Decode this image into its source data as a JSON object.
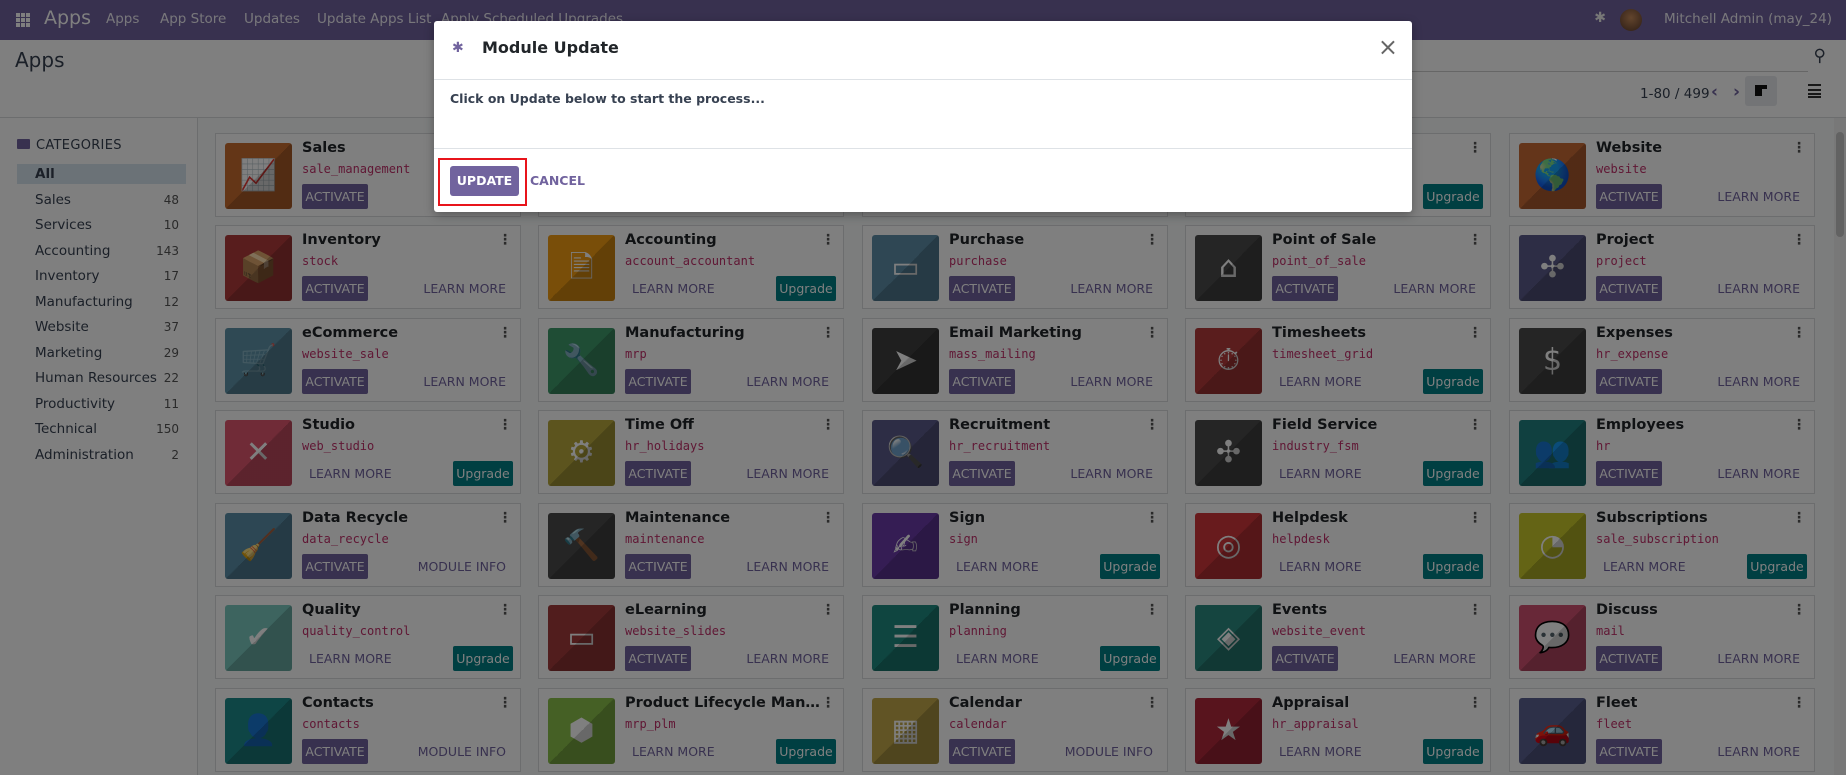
{
  "navbar": {
    "brand": "Apps",
    "items": [
      "Apps",
      "App Store",
      "Updates",
      "Update Apps List",
      "Apply Scheduled Upgrades"
    ],
    "user": "Mitchell Admin (may_24)"
  },
  "control_panel": {
    "title": "Apps",
    "pager": "1-80 / 499"
  },
  "sidebar": {
    "header": "CATEGORIES",
    "items": [
      {
        "label": "All",
        "count": ""
      },
      {
        "label": "Sales",
        "count": "48"
      },
      {
        "label": "Services",
        "count": "10"
      },
      {
        "label": "Accounting",
        "count": "143"
      },
      {
        "label": "Inventory",
        "count": "17"
      },
      {
        "label": "Manufacturing",
        "count": "12"
      },
      {
        "label": "Website",
        "count": "37"
      },
      {
        "label": "Marketing",
        "count": "29"
      },
      {
        "label": "Human Resources",
        "count": "22"
      },
      {
        "label": "Productivity",
        "count": "11"
      },
      {
        "label": "Technical",
        "count": "150"
      },
      {
        "label": "Administration",
        "count": "2"
      }
    ]
  },
  "colors": {
    "primary": "#71639e",
    "upgrade": "#017e84",
    "highlight": "#e8141b"
  },
  "cards": [
    [
      {
        "name": "Sales",
        "tech": "sale_management",
        "icon": "chart-up-icon",
        "glyph": "📈",
        "color": "#c96d2f",
        "activate": "ACTIVATE"
      },
      {
        "hidden": true
      },
      {
        "hidden": true
      },
      {
        "upgrade": "Upgrade"
      },
      {
        "name": "Website",
        "tech": "website",
        "icon": "globe-icon",
        "glyph": "🌎",
        "color": "#c86a35",
        "activate": "ACTIVATE",
        "link": "LEARN MORE"
      }
    ],
    [
      {
        "name": "Inventory",
        "tech": "stock",
        "icon": "box-icon",
        "glyph": "📦",
        "color": "#b03a3a",
        "activate": "ACTIVATE",
        "link": "LEARN MORE"
      },
      {
        "name": "Accounting",
        "tech": "account_accountant",
        "icon": "document-icon",
        "glyph": "🗎",
        "color": "#f39c12",
        "link": "LEARN MORE",
        "upgrade": "Upgrade"
      },
      {
        "name": "Purchase",
        "tech": "purchase",
        "icon": "credit-card-icon",
        "glyph": "▭",
        "color": "#5e8fa8",
        "activate": "ACTIVATE",
        "link": "LEARN MORE"
      },
      {
        "name": "Point of Sale",
        "tech": "point_of_sale",
        "icon": "store-icon",
        "glyph": "⌂",
        "color": "#4a4a4a",
        "activate": "ACTIVATE",
        "link": "LEARN MORE"
      },
      {
        "name": "Project",
        "tech": "project",
        "icon": "puzzle-icon",
        "glyph": "✣",
        "color": "#5a5a8a",
        "activate": "ACTIVATE",
        "link": "LEARN MORE"
      }
    ],
    [
      {
        "name": "eCommerce",
        "tech": "website_sale",
        "icon": "cart-icon",
        "glyph": "🛒",
        "color": "#5f93a8",
        "activate": "ACTIVATE",
        "link": "LEARN MORE"
      },
      {
        "name": "Manufacturing",
        "tech": "mrp",
        "icon": "wrench-icon",
        "glyph": "🔧",
        "color": "#3f9a6b",
        "activate": "ACTIVATE",
        "link": "LEARN MORE"
      },
      {
        "name": "Email Marketing",
        "tech": "mass_mailing",
        "icon": "paper-plane-icon",
        "glyph": "➤",
        "color": "#3e3e3e",
        "activate": "ACTIVATE",
        "link": "LEARN MORE"
      },
      {
        "name": "Timesheets",
        "tech": "timesheet_grid",
        "icon": "stopwatch-icon",
        "glyph": "⏱",
        "color": "#b53a3a",
        "link": "LEARN MORE",
        "upgrade": "Upgrade"
      },
      {
        "name": "Expenses",
        "tech": "hr_expense",
        "icon": "user-dollar-icon",
        "glyph": "$",
        "color": "#4a4a4a",
        "activate": "ACTIVATE",
        "link": "LEARN MORE"
      }
    ],
    [
      {
        "name": "Studio",
        "tech": "web_studio",
        "icon": "tools-icon",
        "glyph": "✕",
        "color": "#e0576e",
        "link": "LEARN MORE",
        "upgrade": "Upgrade"
      },
      {
        "name": "Time Off",
        "tech": "hr_holidays",
        "icon": "user-gear-icon",
        "glyph": "⚙",
        "color": "#b8a83c",
        "activate": "ACTIVATE",
        "link": "LEARN MORE"
      },
      {
        "name": "Recruitment",
        "tech": "hr_recruitment",
        "icon": "magnifier-user-icon",
        "glyph": "🔍",
        "color": "#5a5a8a",
        "activate": "ACTIVATE",
        "link": "LEARN MORE"
      },
      {
        "name": "Field Service",
        "tech": "industry_fsm",
        "icon": "puzzle-timer-icon",
        "glyph": "✣",
        "color": "#4a4a4a",
        "link": "LEARN MORE",
        "upgrade": "Upgrade"
      },
      {
        "name": "Employees",
        "tech": "hr",
        "icon": "users-icon",
        "glyph": "👥",
        "color": "#208080",
        "activate": "ACTIVATE",
        "link": "LEARN MORE"
      }
    ],
    [
      {
        "name": "Data Recycle",
        "tech": "data_recycle",
        "icon": "broom-icon",
        "glyph": "🧹",
        "color": "#5a8fa8",
        "activate": "ACTIVATE",
        "link": "MODULE INFO"
      },
      {
        "name": "Maintenance",
        "tech": "maintenance",
        "icon": "hammer-icon",
        "glyph": "🔨",
        "color": "#4a4a4a",
        "activate": "ACTIVATE",
        "link": "LEARN MORE"
      },
      {
        "name": "Sign",
        "tech": "sign",
        "icon": "sign-document-icon",
        "glyph": "✍",
        "color": "#6a3aa8",
        "link": "LEARN MORE",
        "upgrade": "Upgrade"
      },
      {
        "name": "Helpdesk",
        "tech": "helpdesk",
        "icon": "lifebuoy-icon",
        "glyph": "◎",
        "color": "#d0363a",
        "link": "LEARN MORE",
        "upgrade": "Upgrade"
      },
      {
        "name": "Subscriptions",
        "tech": "sale_subscription",
        "icon": "rss-pen-icon",
        "glyph": "◔",
        "color": "#c8c82a",
        "link": "LEARN MORE",
        "upgrade": "Upgrade"
      }
    ],
    [
      {
        "name": "Quality",
        "tech": "quality_control",
        "icon": "clipboard-check-icon",
        "glyph": "✔",
        "color": "#7ac9bf",
        "link": "LEARN MORE",
        "upgrade": "Upgrade"
      },
      {
        "name": "eLearning",
        "tech": "website_slides",
        "icon": "presentation-icon",
        "glyph": "▭",
        "color": "#a33a3a",
        "activate": "ACTIVATE",
        "link": "LEARN MORE"
      },
      {
        "name": "Planning",
        "tech": "planning",
        "icon": "planning-icon",
        "glyph": "☰",
        "color": "#1f8a80",
        "link": "LEARN MORE",
        "upgrade": "Upgrade"
      },
      {
        "name": "Events",
        "tech": "website_event",
        "icon": "ticket-icon",
        "glyph": "◈",
        "color": "#2a8a80",
        "activate": "ACTIVATE",
        "link": "LEARN MORE"
      },
      {
        "name": "Discuss",
        "tech": "mail",
        "icon": "chat-bubble-icon",
        "glyph": "💬",
        "color": "#d05070",
        "activate": "ACTIVATE",
        "link": "LEARN MORE"
      }
    ],
    [
      {
        "name": "Contacts",
        "tech": "contacts",
        "icon": "address-book-icon",
        "glyph": "👤",
        "color": "#1d8a8a",
        "activate": "ACTIVATE",
        "link": "MODULE INFO"
      },
      {
        "name": "Product Lifecycle Manageme...",
        "tech": "mrp_plm",
        "icon": "cube-arrows-icon",
        "glyph": "⬢",
        "color": "#8ac04a",
        "link": "LEARN MORE",
        "upgrade": "Upgrade"
      },
      {
        "name": "Calendar",
        "tech": "calendar",
        "icon": "calendar-icon",
        "glyph": "▦",
        "color": "#c2a84a",
        "activate": "ACTIVATE",
        "link": "MODULE INFO"
      },
      {
        "name": "Appraisal",
        "tech": "hr_appraisal",
        "icon": "star-icon",
        "glyph": "★",
        "color": "#b0283a",
        "link": "LEARN MORE",
        "upgrade": "Upgrade"
      },
      {
        "name": "Fleet",
        "tech": "fleet",
        "icon": "car-icon",
        "glyph": "🚗",
        "color": "#5a6090",
        "activate": "ACTIVATE",
        "link": "LEARN MORE"
      }
    ]
  ],
  "modal": {
    "title": "Module Update",
    "body": "Click on Update below to start the process...",
    "update_label": "UPDATE",
    "cancel_label": "CANCEL",
    "close_glyph": "×"
  }
}
